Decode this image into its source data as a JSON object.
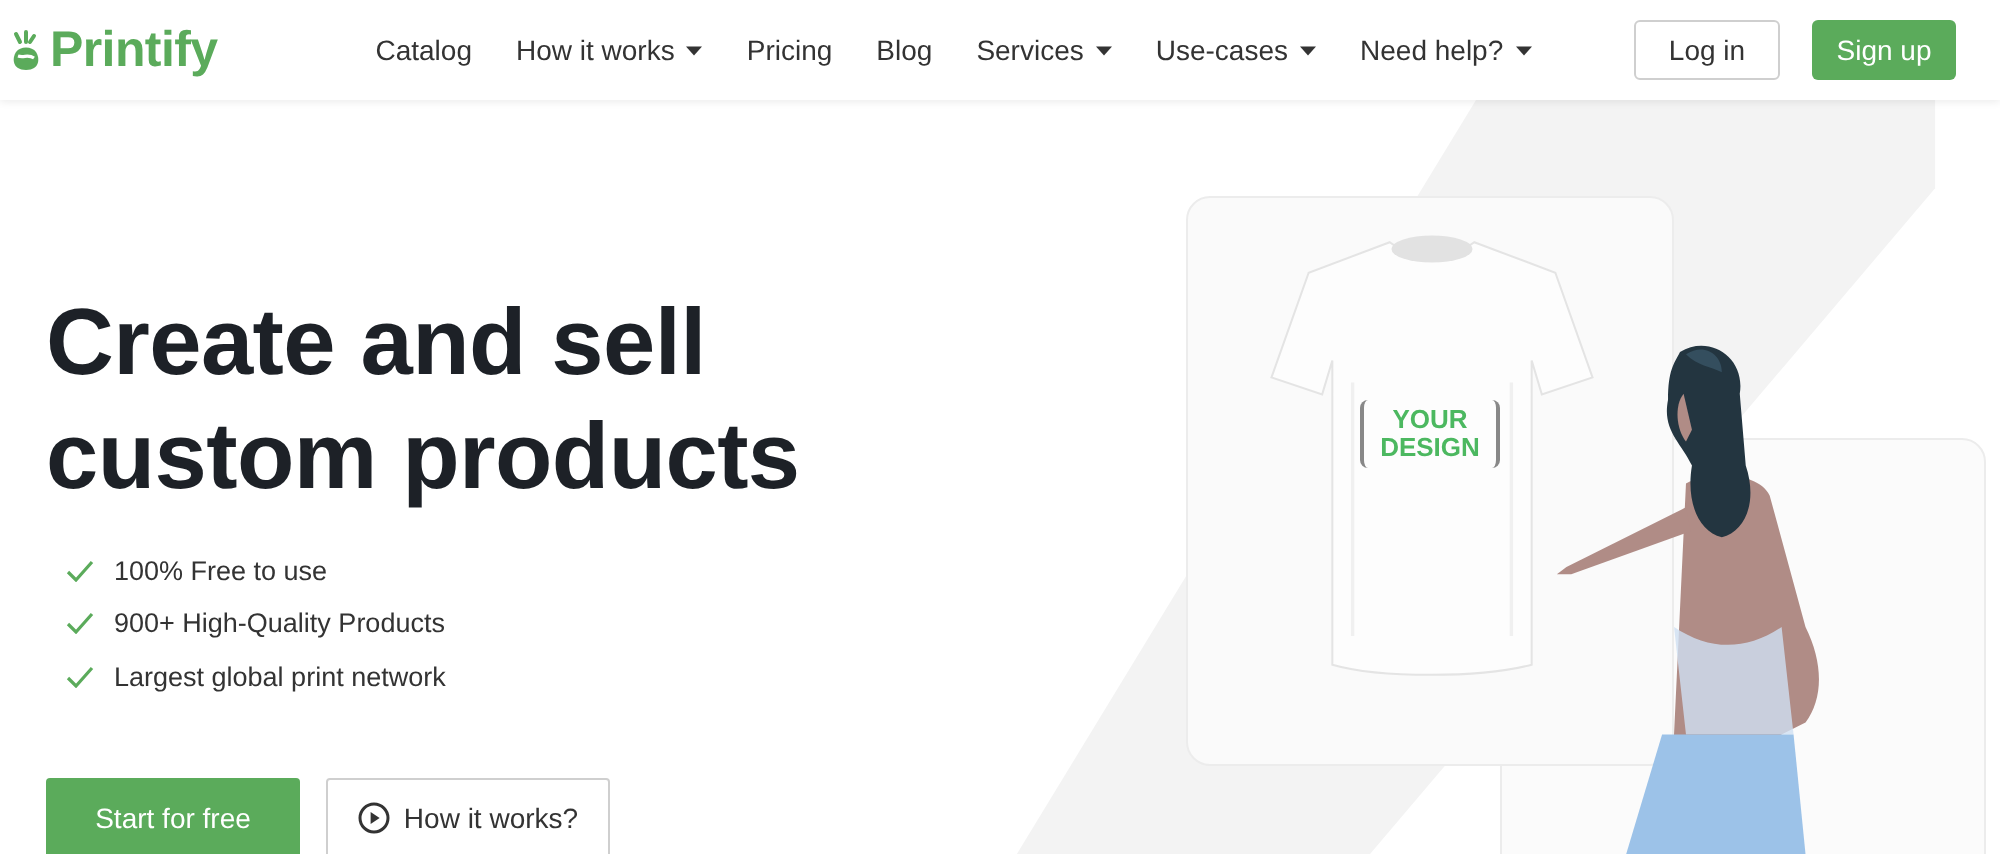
{
  "header": {
    "logo": "Printify",
    "nav": [
      {
        "label": "Catalog",
        "dropdown": false
      },
      {
        "label": "How it works",
        "dropdown": true
      },
      {
        "label": "Pricing",
        "dropdown": false
      },
      {
        "label": "Blog",
        "dropdown": false
      },
      {
        "label": "Services",
        "dropdown": true
      },
      {
        "label": "Use-cases",
        "dropdown": true
      },
      {
        "label": "Need help?",
        "dropdown": true
      }
    ],
    "login": "Log in",
    "signup": "Sign up"
  },
  "hero": {
    "title_lines": [
      "Create and sell",
      "custom products"
    ],
    "features": [
      "100% Free to use",
      "900+ High-Quality Products",
      "Largest global print network"
    ],
    "primary_button": "Start for free",
    "secondary_button": "How it works?",
    "shirt_print": [
      "YOUR",
      "DESIGN"
    ]
  }
}
